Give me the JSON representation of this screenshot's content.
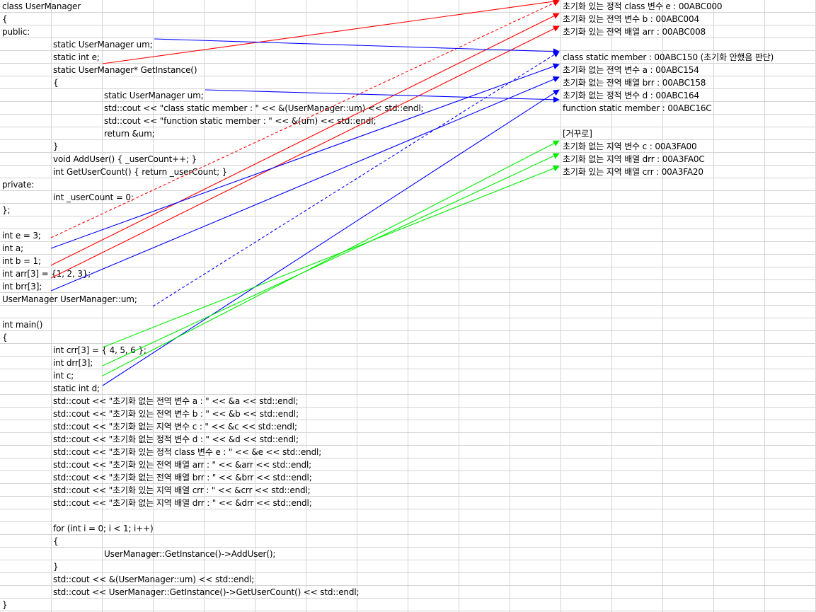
{
  "code_lines": [
    {
      "row": 0,
      "indent": 0,
      "text": "class UserManager"
    },
    {
      "row": 1,
      "indent": 0,
      "text": "{"
    },
    {
      "row": 2,
      "indent": 0,
      "text": "public:"
    },
    {
      "row": 3,
      "indent": 1,
      "text": "static UserManager um;"
    },
    {
      "row": 4,
      "indent": 1,
      "text": "static int e;"
    },
    {
      "row": 5,
      "indent": 1,
      "text": "static UserManager* GetInstance()"
    },
    {
      "row": 6,
      "indent": 1,
      "text": "{"
    },
    {
      "row": 7,
      "indent": 2,
      "text": "static UserManager um;"
    },
    {
      "row": 8,
      "indent": 2,
      "text": "std::cout << \"class static member : \" << &(UserManager::um) << std::endl;"
    },
    {
      "row": 9,
      "indent": 2,
      "text": "std::cout << \"function static member : \" << &(um) << std::endl;"
    },
    {
      "row": 10,
      "indent": 2,
      "text": "return &um;"
    },
    {
      "row": 11,
      "indent": 1,
      "text": "}"
    },
    {
      "row": 12,
      "indent": 1,
      "text": "void AddUser() { _userCount++; }"
    },
    {
      "row": 13,
      "indent": 1,
      "text": "int GetUserCount() { return _userCount; }"
    },
    {
      "row": 14,
      "indent": 0,
      "text": "private:"
    },
    {
      "row": 15,
      "indent": 1,
      "text": "int _userCount = 0;"
    },
    {
      "row": 16,
      "indent": 0,
      "text": "};"
    },
    {
      "row": 18,
      "indent": 0,
      "text": "int e = 3;"
    },
    {
      "row": 19,
      "indent": 0,
      "text": "int a;"
    },
    {
      "row": 20,
      "indent": 0,
      "text": "int b = 1;"
    },
    {
      "row": 21,
      "indent": 0,
      "text": "int arr[3] = {1, 2, 3};"
    },
    {
      "row": 22,
      "indent": 0,
      "text": "int brr[3];"
    },
    {
      "row": 23,
      "indent": 0,
      "text": "UserManager UserManager::um;"
    },
    {
      "row": 25,
      "indent": 0,
      "text": "int main()"
    },
    {
      "row": 26,
      "indent": 0,
      "text": "{"
    },
    {
      "row": 27,
      "indent": 1,
      "text": "int crr[3] = { 4, 5, 6 };"
    },
    {
      "row": 28,
      "indent": 1,
      "text": "int drr[3];"
    },
    {
      "row": 29,
      "indent": 1,
      "text": "int c;"
    },
    {
      "row": 30,
      "indent": 1,
      "text": "static int d;"
    },
    {
      "row": 31,
      "indent": 1,
      "text": "std::cout << \"초기화 없는 전역 변수 a : \" << &a << std::endl;"
    },
    {
      "row": 32,
      "indent": 1,
      "text": "std::cout << \"초기화 있는 전역 변수 b : \" << &b << std::endl;"
    },
    {
      "row": 33,
      "indent": 1,
      "text": "std::cout << \"초기화 없는 지역 변수 c : \" << &c << std::endl;"
    },
    {
      "row": 34,
      "indent": 1,
      "text": "std::cout << \"초기화 없는 정적 변수 d : \" << &d << std::endl;"
    },
    {
      "row": 35,
      "indent": 1,
      "text": "std::cout << \"초기화 있는 정적 class 변수 e : \" << &e << std::endl;"
    },
    {
      "row": 36,
      "indent": 1,
      "text": "std::cout << \"초기화 있는 전역 배열 arr : \" << &arr << std::endl;"
    },
    {
      "row": 37,
      "indent": 1,
      "text": "std::cout << \"초기화 없는 전역 배열 brr : \" << &brr << std::endl;"
    },
    {
      "row": 38,
      "indent": 1,
      "text": "std::cout << \"초기화 있는 지역 배열 crr : \" << &crr << std::endl;"
    },
    {
      "row": 39,
      "indent": 1,
      "text": "std::cout << \"초기화 없는 지역 배열 drr : \" << &drr << std::endl;"
    },
    {
      "row": 41,
      "indent": 1,
      "text": "for (int i = 0; i < 1; i++)"
    },
    {
      "row": 42,
      "indent": 1,
      "text": "{"
    },
    {
      "row": 43,
      "indent": 2,
      "text": "UserManager::GetInstance()->AddUser();"
    },
    {
      "row": 44,
      "indent": 1,
      "text": "}"
    },
    {
      "row": 45,
      "indent": 1,
      "text": "std::cout << &(UserManager::um) << std::endl;"
    },
    {
      "row": 46,
      "indent": 1,
      "text": "std::cout << UserManager::GetInstance()->GetUserCount() << std::endl;"
    },
    {
      "row": 47,
      "indent": 0,
      "text": "}"
    }
  ],
  "output_lines": [
    {
      "row": 0,
      "text": "초기화 있는 정적 class 변수 e : 00ABC000"
    },
    {
      "row": 1,
      "text": "초기화 있는 전역 변수 b : 00ABC004"
    },
    {
      "row": 2,
      "text": "초기화 있는 전역 배열 arr : 00ABC008"
    },
    {
      "row": 4,
      "text": "class static member : 00ABC150 (초기화 안했음 판단)"
    },
    {
      "row": 5,
      "text": "초기화 없는 전역 변수 a : 00ABC154"
    },
    {
      "row": 6,
      "text": "초기화 없는 전역 배열 brr : 00ABC158"
    },
    {
      "row": 7,
      "text": "초기화 없는 정적 변수 d : 00ABC164"
    },
    {
      "row": 8,
      "text": "function static member : 00ABC16C"
    },
    {
      "row": 10,
      "text": "[거꾸로]"
    },
    {
      "row": 11,
      "text": "초기화 없는 지역 변수 c : 00A3FA00"
    },
    {
      "row": 12,
      "text": "초기화 없는 지역 배열 drr : 00A3FA0C"
    },
    {
      "row": 13,
      "text": "초기화 있는 지역 배열 crr : 00A3FA20"
    }
  ],
  "colors": {
    "initialized_global": "#ff0000",
    "uninitialized_global": "#0000ff",
    "local": "#00ee00",
    "grid": "#d4d4d4"
  },
  "connectors": [
    {
      "name": "arrow-static-e",
      "color": "initialized_global",
      "from": 4,
      "to": 0,
      "dashed": false
    },
    {
      "name": "arrow-global-e",
      "color": "initialized_global",
      "from": 18,
      "to": 0,
      "dashed": true
    },
    {
      "name": "arrow-global-b",
      "color": "initialized_global",
      "from": 20,
      "to": 1,
      "dashed": false
    },
    {
      "name": "arrow-global-arr",
      "color": "initialized_global",
      "from": 21,
      "to": 2,
      "dashed": false
    },
    {
      "name": "arrow-class-um",
      "color": "uninitialized_global",
      "from": 3,
      "to": 4,
      "dashed": false
    },
    {
      "name": "arrow-def-um",
      "color": "uninitialized_global",
      "from": 23,
      "to": 4,
      "dashed": true
    },
    {
      "name": "arrow-global-a",
      "color": "uninitialized_global",
      "from": 19,
      "to": 5,
      "dashed": false
    },
    {
      "name": "arrow-global-brr",
      "color": "uninitialized_global",
      "from": 22,
      "to": 6,
      "dashed": false
    },
    {
      "name": "arrow-static-d",
      "color": "uninitialized_global",
      "from": 30,
      "to": 7,
      "dashed": false
    },
    {
      "name": "arrow-function-um",
      "color": "uninitialized_global",
      "from": 7,
      "to": 8,
      "dashed": false
    },
    {
      "name": "arrow-local-c",
      "color": "local",
      "from": 29,
      "to": 11,
      "dashed": false
    },
    {
      "name": "arrow-local-drr",
      "color": "local",
      "from": 28,
      "to": 12,
      "dashed": false
    },
    {
      "name": "arrow-local-crr",
      "color": "local",
      "from": 27,
      "to": 13,
      "dashed": false
    }
  ]
}
